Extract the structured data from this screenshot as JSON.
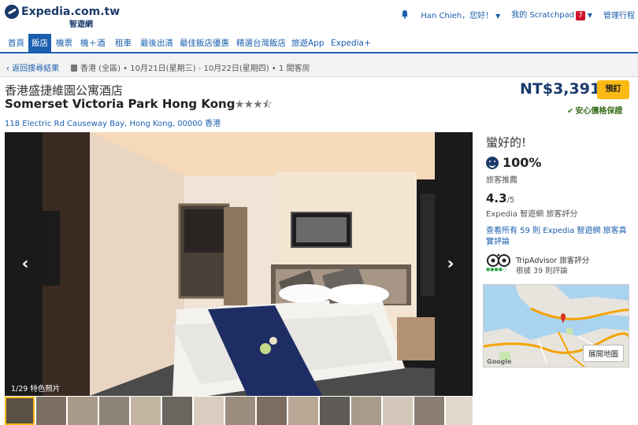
{
  "header": {
    "logo_text": "Expedia.com.tw",
    "logo_sub": "智遊網",
    "user_greeting": "Han Chieh，您好！",
    "scratchpad_label": "我的 Scratchpad",
    "scratchpad_count": "7",
    "manage_trips": "管理行程"
  },
  "nav": {
    "items": [
      "首頁",
      "飯店",
      "機票",
      "機＋酒",
      "租車",
      "最後出清",
      "最佳飯店優惠",
      "精選台灣飯店",
      "旅遊App",
      "Expedia+"
    ],
    "active_index": 1
  },
  "crumb": {
    "back": "返回搜尋結果",
    "trip": "香港 (全區) • 10月21日(星期三) - 10月22日(星期四) • 1 間客房"
  },
  "hotel": {
    "name_zh": "香港盛捷維園公寓酒店",
    "name_en": "Somerset Victoria Park Hong Kong",
    "stars_rating": 3.5,
    "stars": "★★★⯪",
    "address": "118 Electric Rd Causeway Bay, Hong Kong, 00000 香港",
    "price": "NT$3,391",
    "book_label": "預訂",
    "guarantee": "安心價格保證"
  },
  "gallery": {
    "counter": "1/29 特色照片",
    "prev_icon": "chevron-left-icon",
    "next_icon": "chevron-right-icon"
  },
  "reviews": {
    "title": "蠻好的!",
    "percent": "100%",
    "recommend_label": "旅客推薦",
    "score": "4.3",
    "score_max": "/5",
    "score_label": "Expedia 智遊網 旅客評分",
    "read_all": "查看所有 59 則 Expedia 智遊網 旅客真實評論",
    "ta_label": "TripAdvisor 旅客評分",
    "ta_count": "根據 39 則評論"
  },
  "map": {
    "button": "展開地圖",
    "google": "Google"
  },
  "colors": {
    "brand_blue": "#1b5fae",
    "navy": "#1a3a6b",
    "book_yellow": "#fdb913",
    "badge_red": "#d0112b"
  }
}
